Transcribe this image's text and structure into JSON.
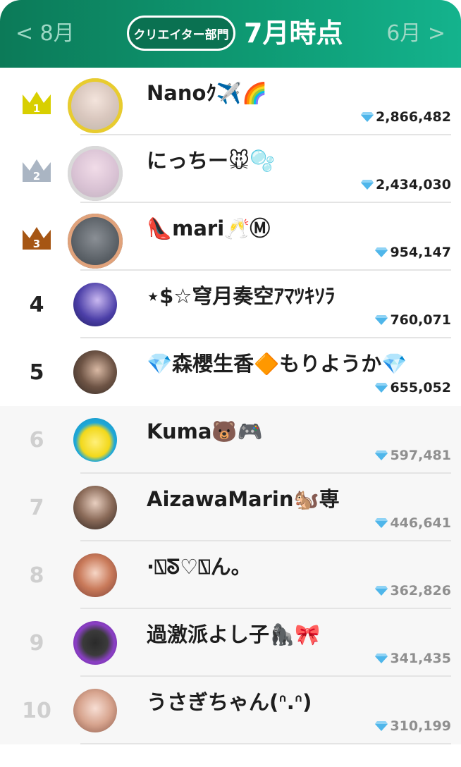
{
  "header": {
    "prev_label": "< 8月",
    "next_label": "6月 >",
    "badge_label": "クリエイター部門",
    "title": "7月時点"
  },
  "colors": {
    "header_start": "#0c7a58",
    "header_end": "#14b38d",
    "gold": "#d8cf00",
    "silver": "#aab5c3",
    "bronze": "#a65614",
    "gem": "#4fb6ea"
  },
  "rankings": [
    {
      "rank": "1",
      "name": "Nanoｸ✈️🌈",
      "score": "2,866,482",
      "badge": "gold-crown-icon"
    },
    {
      "rank": "2",
      "name": "にっちー🐭🫧",
      "score": "2,434,030",
      "badge": "silver-crown-icon"
    },
    {
      "rank": "3",
      "name": "👠mari🥂Ⓜ︎",
      "score": "954,147",
      "badge": "bronze-crown-icon"
    },
    {
      "rank": "4",
      "name": "⋆$☆穹月奏空ｱﾏﾂｷｿﾗ",
      "score": "760,071"
    },
    {
      "rank": "5",
      "name": "💎森櫻生香🔶もりようか💎",
      "score": "655,052"
    },
    {
      "rank": "6",
      "name": "Kuma🐻🎮",
      "score": "597,481"
    },
    {
      "rank": "7",
      "name": "AizawaMarin🐿️専",
      "score": "446,641"
    },
    {
      "rank": "8",
      "name": "·⍂ᘕ♡⍂ん。",
      "score": "362,826"
    },
    {
      "rank": "9",
      "name": "過激派よし子🦍🎀",
      "score": "341,435"
    },
    {
      "rank": "10",
      "name": "うさぎちゃん(ᐢ.ᐢ)",
      "score": "310,199"
    }
  ]
}
